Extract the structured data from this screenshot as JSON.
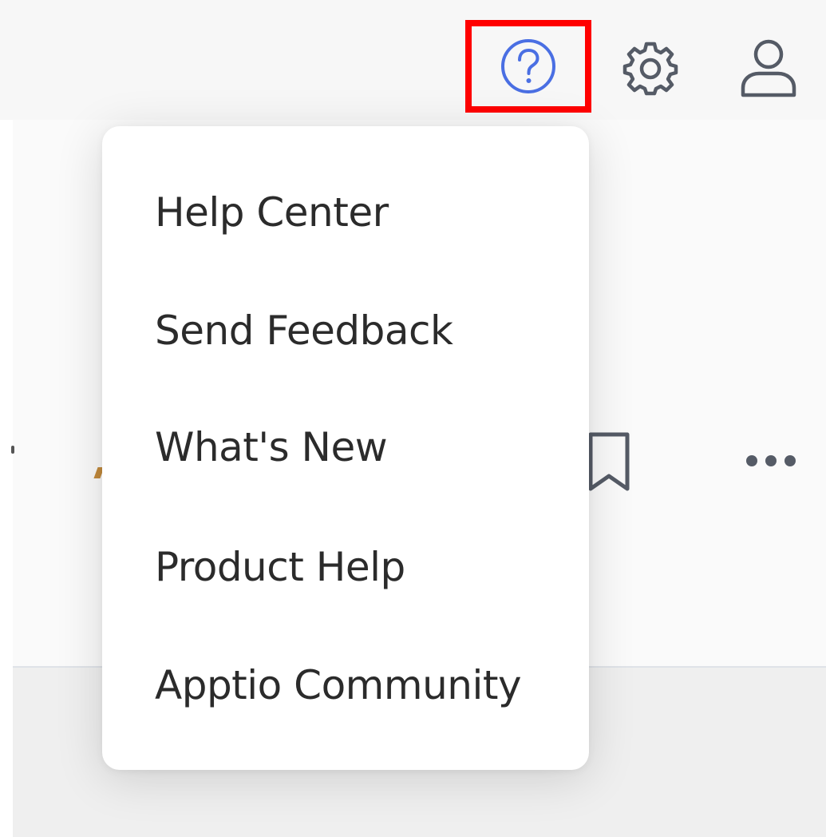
{
  "header": {
    "icons": {
      "help": "question-circle-icon",
      "settings": "gear-icon",
      "user": "user-icon"
    }
  },
  "help_menu": {
    "items": [
      {
        "label": "Help Center"
      },
      {
        "label": "Send Feedback"
      },
      {
        "label": "What's New"
      },
      {
        "label": "Product Help"
      },
      {
        "label": "Apptio Community"
      }
    ]
  },
  "toolbar": {
    "icons": {
      "bookmark": "bookmark-icon",
      "more": "more-horizontal-icon"
    }
  },
  "colors": {
    "help_icon": "#4a6fe3",
    "icon_gray": "#555b66",
    "highlight_border": "#ff0000",
    "menu_text": "#2b2b2b",
    "menu_background": "#ffffff"
  }
}
